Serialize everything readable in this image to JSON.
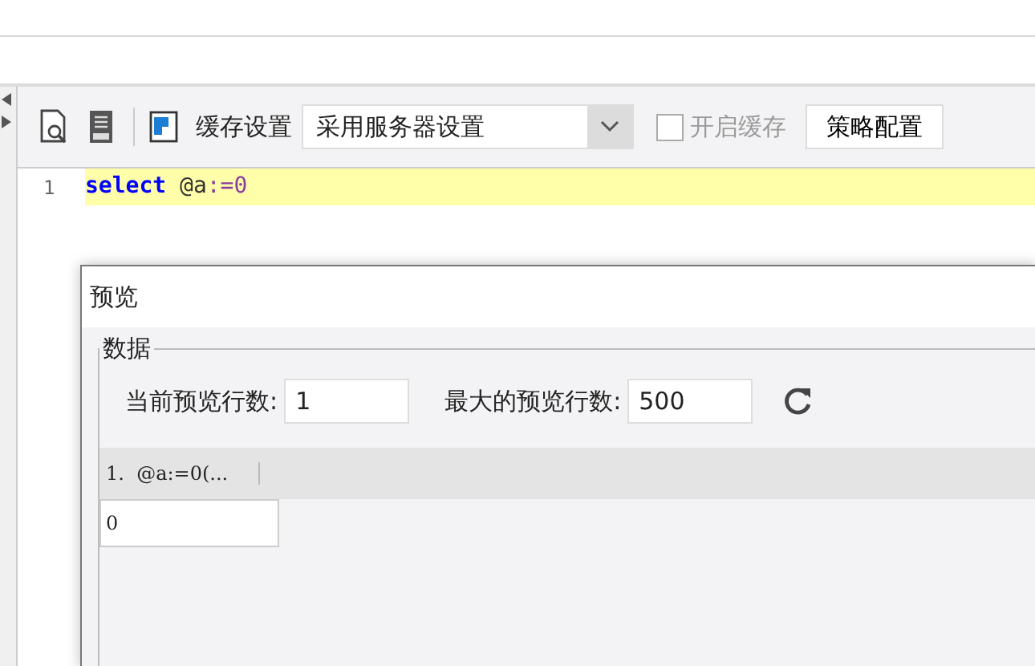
{
  "toolbar": {
    "cache_label": "缓存设置",
    "cache_select": "采用服务器设置",
    "enable_cache": {
      "label": "开启缓存",
      "checked": false,
      "disabled": true
    },
    "strategy_button": "策略配置"
  },
  "editor": {
    "lines": [
      {
        "number": "1",
        "tokens": [
          {
            "kind": "keyword",
            "text": "select"
          },
          {
            "kind": "variable",
            "text": "@a"
          },
          {
            "kind": "operator",
            "text": ":="
          },
          {
            "kind": "number",
            "text": "0"
          }
        ]
      }
    ]
  },
  "dialog": {
    "title": "预览",
    "group_title": "数据",
    "current_rows_label": "当前预览行数:",
    "current_rows": "1",
    "max_rows_label": "最大的预览行数:",
    "max_rows": "500",
    "table": {
      "columns": [
        "1.  @a:=0(..."
      ],
      "rows": [
        [
          "0"
        ]
      ]
    }
  }
}
